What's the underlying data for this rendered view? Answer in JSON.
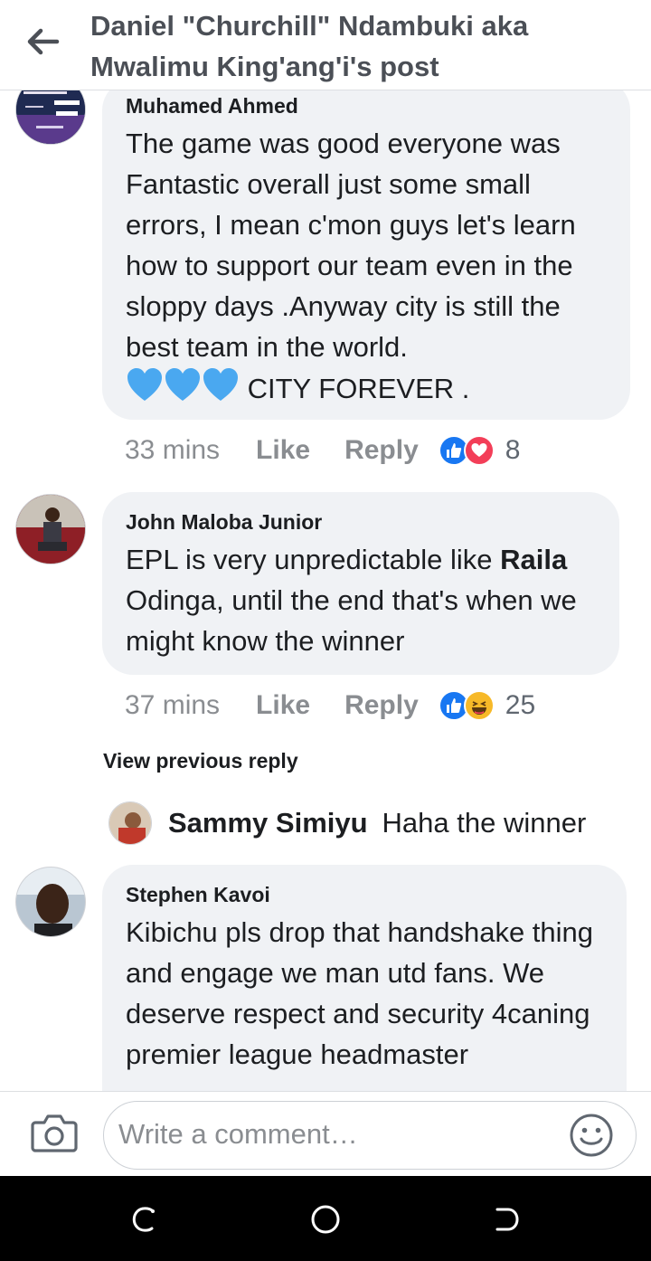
{
  "header": {
    "title": "Daniel \"Churchill\" Ndambuki aka Mwalimu King'ang'i's post"
  },
  "comments": [
    {
      "author": "Muhamed Ahmed",
      "text": "The game was good everyone was Fantastic overall just some small errors, I mean c'mon guys let's learn how to support our team even in the sloppy days .Anyway city is still the best team in the world.",
      "text_tail": " CITY FOREVER .",
      "time": "33 mins",
      "like_label": "Like",
      "reply_label": "Reply",
      "reaction_count": "8",
      "reactions": [
        "like-icon",
        "love-icon"
      ]
    },
    {
      "author": "John Maloba Junior",
      "text_before": "EPL is very unpredictable like ",
      "text_bold": "Raila",
      "text_after": " Odinga, until the end that's when we might know the winner",
      "time": "37 mins",
      "like_label": "Like",
      "reply_label": "Reply",
      "reaction_count": "25",
      "reactions": [
        "like-icon",
        "haha-icon"
      ]
    },
    {
      "author": "Stephen Kavoi",
      "text": "Kibichu pls drop that handshake thing and engage we man utd fans. We deserve respect and security 4caning premier league headmaster"
    }
  ],
  "view_previous_reply": "View previous reply",
  "reply": {
    "author": "Sammy Simiyu",
    "text": "Haha the winner"
  },
  "composer": {
    "placeholder": "Write a comment…"
  },
  "colors": {
    "bubble": "#f0f2f5",
    "like_blue": "#1877f2",
    "love_red": "#f33e58",
    "haha_yellow": "#f7b928",
    "heart_blue": "#4aa8f0"
  }
}
